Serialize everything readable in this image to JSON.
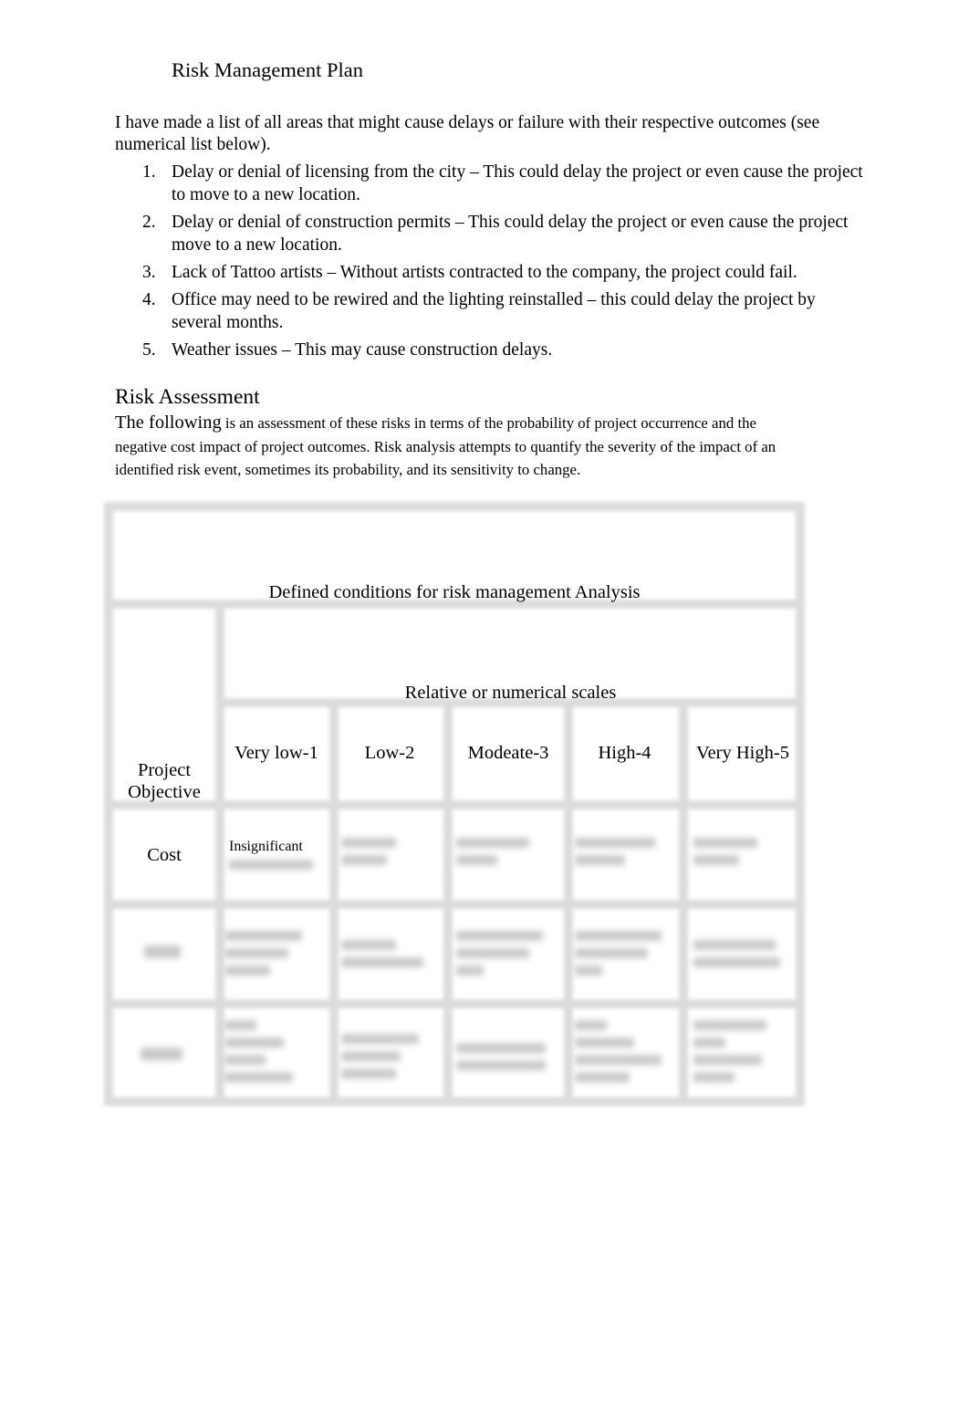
{
  "document": {
    "title": "Risk Management Plan",
    "intro": "I have made a list of all areas that might cause delays or failure with their respective outcomes (see numerical list below).",
    "risks": [
      {
        "number": "1.",
        "text": "Delay or denial of licensing from the city – This could delay the project or even cause the project to move to a new location."
      },
      {
        "number": "2.",
        "text": "Delay or denial of construction permits – This could delay the project or even cause the project move to a new location."
      },
      {
        "number": "3.",
        "text": "Lack of Tattoo artists – Without artists contracted to the company, the project could fail."
      },
      {
        "number": "4.",
        "text": "Office may need to be rewired and the lighting reinstalled – this could delay the project by several months."
      },
      {
        "number": "5.",
        "text": "Weather issues – This may cause construction delays."
      }
    ],
    "assessment": {
      "heading": "Risk Assessment",
      "lead": "The following",
      "body": " is an assessment of these risks in terms of the probability of project occurrence and the negative cost impact of project outcomes. Risk analysis attempts to quantify the severity of the impact of an identified risk event, sometimes its probability, and its sensitivity to change."
    }
  },
  "table": {
    "caption": "Defined conditions for risk management Analysis",
    "scale_header": "Relative or numerical scales",
    "objective_header": "Project Objective",
    "scale_levels": [
      "Very low-1",
      "Low-2",
      "Modeate-3",
      "High-4",
      "Very High-5"
    ],
    "rows": [
      {
        "objective": "Cost",
        "cells": [
          "Insignificant",
          "",
          "",
          "",
          ""
        ],
        "blurred": false
      },
      {
        "objective": "",
        "cells": [
          "",
          "",
          "",
          "",
          ""
        ],
        "blurred": true
      },
      {
        "objective": "",
        "cells": [
          "",
          "",
          "",
          "",
          ""
        ],
        "blurred": true
      }
    ],
    "blurred_note": "remaining cell content is obscured (blurred) in the screenshot"
  }
}
